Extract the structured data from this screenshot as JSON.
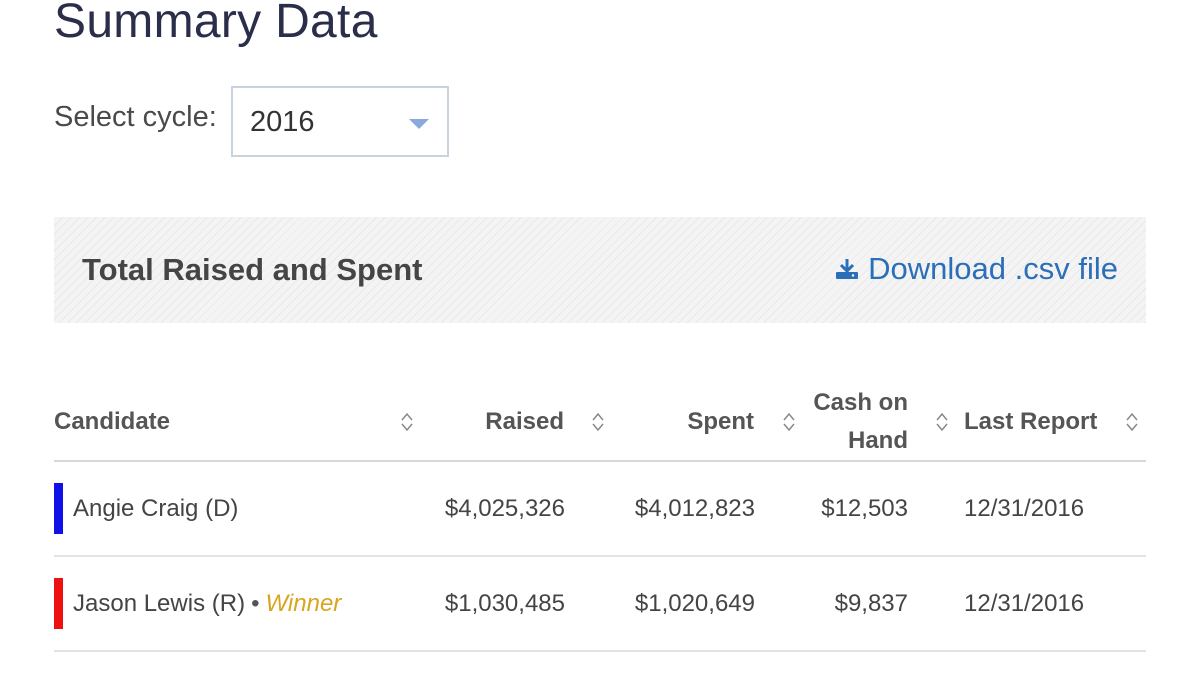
{
  "page": {
    "title": "Summary Data"
  },
  "cycle": {
    "label": "Select cycle:",
    "selected": "2016"
  },
  "panel": {
    "title": "Total Raised and Spent",
    "download_label": "Download .csv file",
    "download_icon": "download-icon"
  },
  "table": {
    "headers": {
      "candidate": "Candidate",
      "raised": "Raised",
      "spent": "Spent",
      "cash_on_hand": "Cash on Hand",
      "last_report": "Last Report"
    },
    "sort_icon": "sort-icon",
    "rows": [
      {
        "candidate": "Angie Craig (D)",
        "party_color": "#1010e8",
        "raised": "$4,025,326",
        "spent": "$4,012,823",
        "cash_on_hand": "$12,503",
        "last_report": "12/31/2016",
        "winner": ""
      },
      {
        "candidate": "Jason Lewis (R)",
        "party_color": "#ee1111",
        "raised": "$1,030,485",
        "spent": "$1,020,649",
        "cash_on_hand": "$9,837",
        "last_report": "12/31/2016",
        "winner_separator": "•",
        "winner": "Winner"
      }
    ]
  },
  "colors": {
    "title": "#2a2e4a",
    "link": "#2a6fb8",
    "winner": "#d9a520",
    "democrat": "#1010e8",
    "republican": "#ee1111"
  }
}
